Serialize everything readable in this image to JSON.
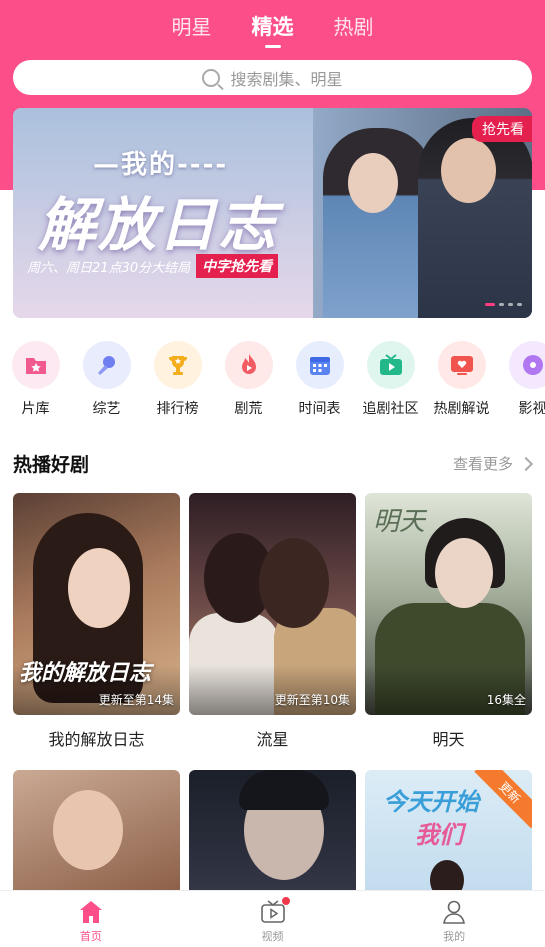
{
  "top_tabs": [
    {
      "label": "明星",
      "active": false
    },
    {
      "label": "精选",
      "active": true
    },
    {
      "label": "热剧",
      "active": false
    }
  ],
  "search": {
    "placeholder": "搜索剧集、明星"
  },
  "banner": {
    "badge": "抢先看",
    "small_title": "—我的----",
    "big_title": "解放日志",
    "tagline": "周六、周日21点30分大结局",
    "tagline_highlight": "中字抢先看"
  },
  "categories": [
    {
      "label": "片库",
      "icon": "folder-star-icon",
      "bg": "#fde9f1",
      "color": "#f15a8e"
    },
    {
      "label": "综艺",
      "icon": "microphone-icon",
      "bg": "#e8ecfd",
      "color": "#6f7ff0"
    },
    {
      "label": "排行榜",
      "icon": "trophy-icon",
      "bg": "#fff2de",
      "color": "#f4ad1c"
    },
    {
      "label": "剧荒",
      "icon": "flame-icon",
      "bg": "#ffe8e8",
      "color": "#f35b62"
    },
    {
      "label": "时间表",
      "icon": "calendar-icon",
      "bg": "#e6edfd",
      "color": "#5c84f0"
    },
    {
      "label": "追剧社区",
      "icon": "tv-icon",
      "bg": "#dff6ef",
      "color": "#22b88a"
    },
    {
      "label": "热剧解说",
      "icon": "tv-heart-icon",
      "bg": "#ffe8e6",
      "color": "#f1544f"
    },
    {
      "label": "影视",
      "icon": "film-icon",
      "bg": "#f3e8fd",
      "color": "#b077f0"
    }
  ],
  "section": {
    "title": "热播好剧",
    "more": "查看更多"
  },
  "shows": [
    {
      "title": "我的解放日志",
      "status": "更新至第14集",
      "art": "我的解放日志"
    },
    {
      "title": "流星",
      "status": "更新至第10集"
    },
    {
      "title": "明天",
      "status": "16集全",
      "logo": "明天"
    }
  ],
  "shows_row2": [
    {
      "tag": ""
    },
    {
      "tag": ""
    },
    {
      "art_line1": "今天开始",
      "art_line2": "我们",
      "tag": "更新"
    }
  ],
  "bottom_nav": [
    {
      "label": "首页",
      "active": true
    },
    {
      "label": "视频",
      "active": false,
      "dot": true
    },
    {
      "label": "我的",
      "active": false
    }
  ],
  "colors": {
    "brand": "#fc4f8a",
    "badge": "#e4204e"
  }
}
